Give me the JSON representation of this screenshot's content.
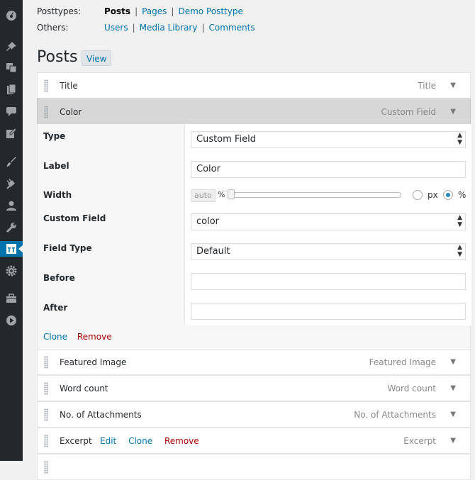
{
  "header": {
    "posttypes_label": "Posttypes:",
    "posttypes": [
      "Posts",
      "Pages",
      "Demo Posttype"
    ],
    "others_label": "Others:",
    "others": [
      "Users",
      "Media Library",
      "Comments"
    ],
    "separator": "|"
  },
  "page": {
    "title": "Posts",
    "view_button": "View"
  },
  "columns": [
    {
      "title": "Title",
      "type": "Title",
      "arrow": "▼"
    },
    {
      "title": "Color",
      "type": "Custom Field",
      "arrow": "▼"
    },
    {
      "title": "Featured Image",
      "type": "Featured Image",
      "arrow": "▼"
    },
    {
      "title": "Word count",
      "type": "Word count",
      "arrow": "▼"
    },
    {
      "title": "No. of Attachments",
      "type": "No. of Attachments",
      "arrow": "▼"
    },
    {
      "title": "Excerpt",
      "type": "Excerpt",
      "arrow": "▼",
      "actions": [
        "Edit",
        "Clone",
        "Remove"
      ]
    }
  ],
  "settings": {
    "type_label": "Type",
    "type_value": "Custom Field",
    "label_label": "Label",
    "label_value": "Color",
    "width_label": "Width",
    "width_auto": "auto",
    "width_unit_symbol": "%",
    "width_unit_px": "px",
    "width_unit_percent": "%",
    "custom_field_label": "Custom Field",
    "custom_field_value": "color",
    "field_type_label": "Field Type",
    "field_type_value": "Default",
    "before_label": "Before",
    "before_value": "",
    "after_label": "After",
    "after_value": "",
    "clone": "Clone",
    "remove": "Remove"
  },
  "colors": {
    "sidebar": "#23282d",
    "active": "#0073aa",
    "link": "#0073aa",
    "remove": "#aa0000"
  },
  "sidebar_icons": [
    "dashboard-icon",
    "pin-icon",
    "media-icon",
    "pages-icon",
    "comments-icon",
    "feedback-icon",
    "appearance-icon",
    "plugins-icon",
    "users-icon",
    "tools-icon",
    "admin-columns-icon",
    "settings-icon",
    "toolbox-icon",
    "play-icon"
  ]
}
